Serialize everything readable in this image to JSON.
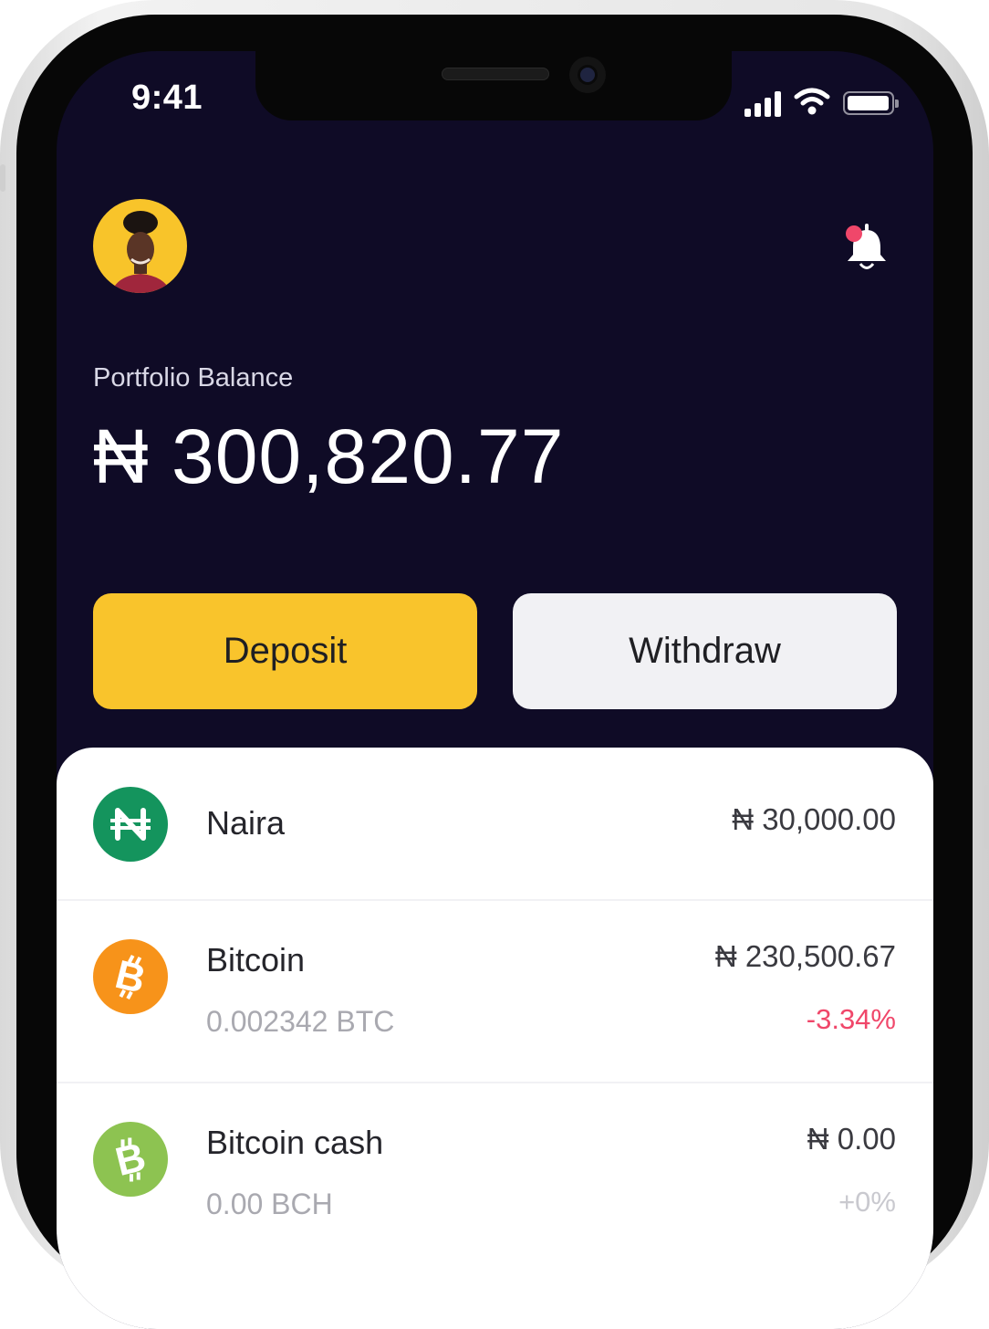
{
  "status_bar": {
    "time": "9:41"
  },
  "header": {
    "avatar_icon": "user-avatar",
    "notification_icon": "bell-icon"
  },
  "portfolio": {
    "label": "Portfolio Balance",
    "amount": "₦ 300,820.77"
  },
  "actions": {
    "deposit_label": "Deposit",
    "withdraw_label": "Withdraw"
  },
  "colors": {
    "background": "#0f0b26",
    "accent": "#f9c42c",
    "negative": "#f0476a",
    "neutral_change": "#c9c9cf",
    "naira": "#14945d",
    "bitcoin": "#f7931a",
    "bitcoin_cash": "#8dc351"
  },
  "assets": [
    {
      "name": "Naira",
      "value": "₦ 30,000.00",
      "quantity": "",
      "change": "",
      "icon": "naira-icon"
    },
    {
      "name": "Bitcoin",
      "value": "₦ 230,500.67",
      "quantity": "0.002342 BTC",
      "change": "-3.34%",
      "icon": "bitcoin-icon"
    },
    {
      "name": "Bitcoin cash",
      "value": "₦ 0.00",
      "quantity": "0.00 BCH",
      "change": "+0%",
      "icon": "bitcoin-cash-icon"
    }
  ]
}
